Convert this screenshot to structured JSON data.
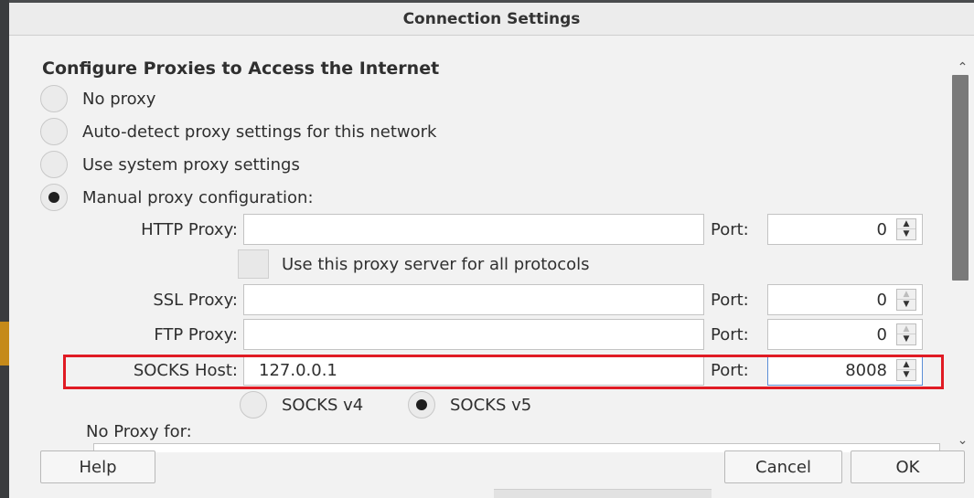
{
  "window": {
    "title": "Connection Settings"
  },
  "section_title": "Configure Proxies to Access the Internet",
  "proxy_options": [
    {
      "label": "No proxy",
      "checked": false
    },
    {
      "label": "Auto-detect proxy settings for this network",
      "checked": false
    },
    {
      "label": "Use system proxy settings",
      "checked": false
    },
    {
      "label": "Manual proxy configuration:",
      "checked": true
    }
  ],
  "http": {
    "label": "HTTP Proxy:",
    "value": "",
    "port_label": "Port:",
    "port": "0"
  },
  "use_for_all": {
    "label": "Use this proxy server for all protocols",
    "checked": false
  },
  "ssl": {
    "label": "SSL Proxy:",
    "value": "",
    "port_label": "Port:",
    "port": "0"
  },
  "ftp": {
    "label": "FTP Proxy:",
    "value": "",
    "port_label": "Port:",
    "port": "0"
  },
  "socks": {
    "label": "SOCKS Host:",
    "value": "127.0.0.1",
    "port_label": "Port:",
    "port": "8008"
  },
  "socks_versions": [
    {
      "label": "SOCKS v4",
      "checked": false
    },
    {
      "label": "SOCKS v5",
      "checked": true
    }
  ],
  "no_proxy_label": "No Proxy for:",
  "buttons": {
    "help": "Help",
    "cancel": "Cancel",
    "ok": "OK"
  },
  "colors": {
    "highlight": "#e01b24",
    "focus": "#5b8fd6"
  },
  "icons": {
    "scroll_up": "chevron-up-icon",
    "scroll_down": "chevron-down-icon",
    "spin_up": "spin-up-icon",
    "spin_down": "spin-down-icon"
  }
}
